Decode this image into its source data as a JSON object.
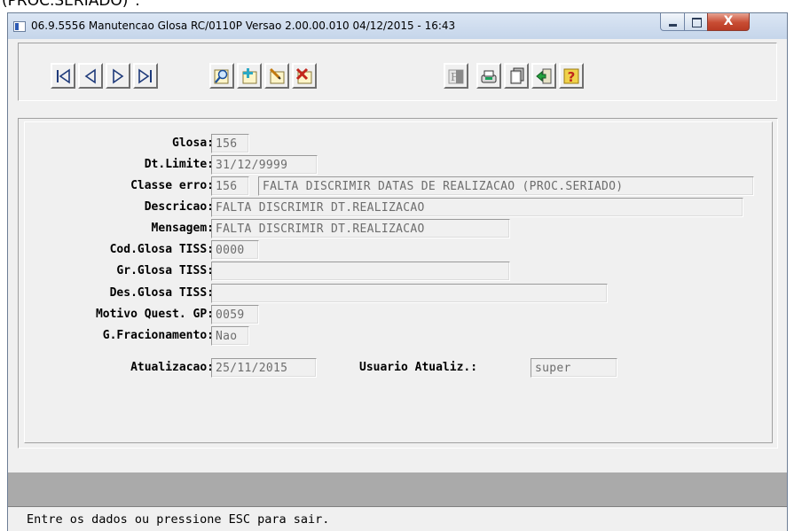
{
  "top_fragment": "(PROC.SERIADO)\".",
  "window": {
    "title": "06.9.5556 Manutencao  Glosa RC/0110P Versao 2.00.00.010 04/12/2015 - 16:43",
    "close_glyph": "X"
  },
  "toolbar": {
    "nav": [
      "first-record-icon",
      "previous-record-icon",
      "next-record-icon",
      "last-record-icon"
    ],
    "actions": [
      "search-icon",
      "add-icon",
      "edit-icon",
      "delete-icon"
    ],
    "tools": [
      "filter-icon",
      "print-icon",
      "copy-icon",
      "exit-icon",
      "help-icon"
    ],
    "filter_glyph": "F",
    "help_glyph": "?"
  },
  "form": {
    "glosa": {
      "label": "Glosa:",
      "value": "156"
    },
    "dt_limite": {
      "label": "Dt.Limite:",
      "value": "31/12/9999"
    },
    "classe_erro": {
      "label": "Classe erro:",
      "code": "156",
      "description": "FALTA DISCRIMIR DATAS DE REALIZACAO (PROC.SERIADO)"
    },
    "descricao": {
      "label": "Descricao:",
      "value": "FALTA DISCRIMIR DT.REALIZACAO"
    },
    "mensagem": {
      "label": "Mensagem:",
      "value": "FALTA DISCRIMIR DT.REALIZACAO"
    },
    "cod_glosa_tiss": {
      "label": "Cod.Glosa TISS:",
      "value": "0000"
    },
    "gr_glosa_tiss": {
      "label": "Gr.Glosa TISS:",
      "value": ""
    },
    "des_glosa_tiss": {
      "label": "Des.Glosa TISS:",
      "value": ""
    },
    "motivo_quest_gp": {
      "label": "Motivo Quest. GP:",
      "value": "0059"
    },
    "g_fracionamento": {
      "label": "G.Fracionamento:",
      "value": "Nao"
    },
    "atualizacao": {
      "label": "Atualizacao:",
      "value": "25/11/2015"
    },
    "usuario_atualiz": {
      "label": "Usuario Atualiz.:",
      "value": "super"
    }
  },
  "status": {
    "message": "Entre os dados ou pressione ESC para sair."
  }
}
